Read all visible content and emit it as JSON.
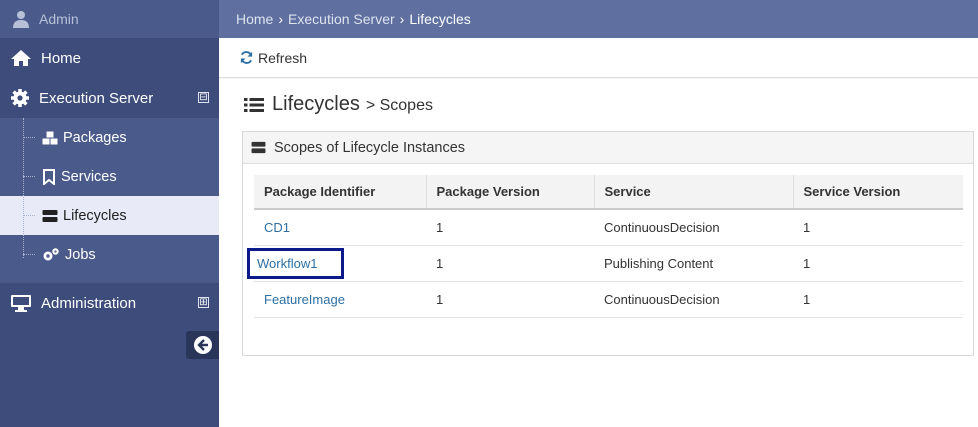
{
  "user": {
    "name": "Admin"
  },
  "nav": {
    "home": "Home",
    "execution_server": "Execution Server",
    "execution_server_toggle": "⊟",
    "children": [
      "Packages",
      "Services",
      "Lifecycles",
      "Jobs"
    ],
    "administration": "Administration",
    "administration_toggle": "⊞"
  },
  "breadcrumb": [
    "Home",
    "Execution Server",
    "Lifecycles"
  ],
  "toolbar": {
    "refresh_label": "Refresh"
  },
  "page": {
    "title": "Lifecycles",
    "subtitle": "> Scopes"
  },
  "panel": {
    "title": "Scopes of Lifecycle Instances"
  },
  "table": {
    "headers": [
      "Package Identifier",
      "Package Version",
      "Service",
      "Service Version"
    ],
    "rows": [
      [
        "CD1",
        "1",
        "ContinuousDecision",
        "1"
      ],
      [
        "Workflow1",
        "1",
        "Publishing Content",
        "1"
      ],
      [
        "FeatureImage",
        "1",
        "ContinuousDecision",
        "1"
      ]
    ]
  },
  "colors": {
    "sidebar": "#3d4c7a",
    "topbar": "#5e6fa0",
    "link": "#2c6fa5",
    "highlight": "#0a1a8a"
  }
}
